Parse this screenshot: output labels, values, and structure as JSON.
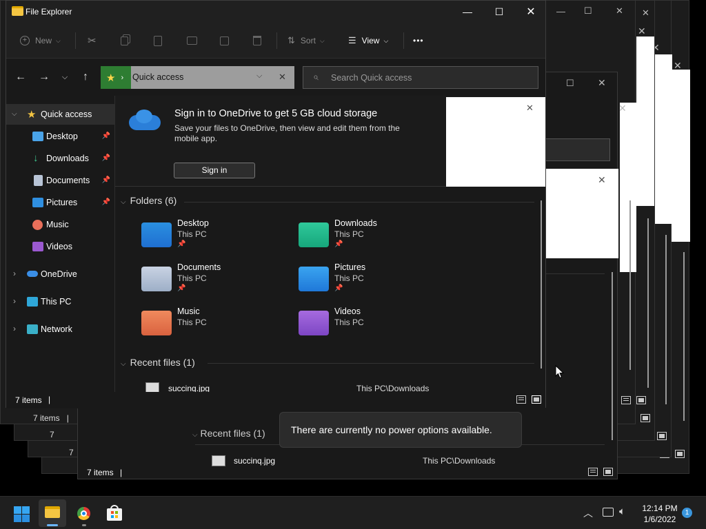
{
  "window": {
    "title": "File Explorer",
    "minimize": "—",
    "maximize": "☐",
    "close": "✕"
  },
  "toolbar": {
    "new_label": "New",
    "sort_label": "Sort",
    "view_label": "View",
    "more_label": "•••"
  },
  "address": {
    "location": "Quick access",
    "search_placeholder": "Search Quick access"
  },
  "sidebar": {
    "items": [
      {
        "label": "Quick access",
        "icon": "star-icon"
      },
      {
        "label": "Desktop",
        "icon": "desktop-icon"
      },
      {
        "label": "Downloads",
        "icon": "downloads-icon"
      },
      {
        "label": "Documents",
        "icon": "documents-icon"
      },
      {
        "label": "Pictures",
        "icon": "pictures-icon"
      },
      {
        "label": "Music",
        "icon": "music-icon"
      },
      {
        "label": "Videos",
        "icon": "videos-icon"
      },
      {
        "label": "OneDrive",
        "icon": "cloud-icon"
      },
      {
        "label": "This PC",
        "icon": "pc-icon"
      },
      {
        "label": "Network",
        "icon": "network-icon"
      }
    ]
  },
  "banner": {
    "title": "Sign in to OneDrive to get 5 GB cloud storage",
    "body": "Save your files to OneDrive, then view and edit them from the mobile app.",
    "button": "Sign in"
  },
  "folders": {
    "header": "Folders (6)",
    "items": [
      {
        "name": "Desktop",
        "location": "This PC",
        "pinned": true
      },
      {
        "name": "Downloads",
        "location": "This PC",
        "pinned": true
      },
      {
        "name": "Documents",
        "location": "This PC",
        "pinned": true
      },
      {
        "name": "Pictures",
        "location": "This PC",
        "pinned": true
      },
      {
        "name": "Music",
        "location": "This PC",
        "pinned": false
      },
      {
        "name": "Videos",
        "location": "This PC",
        "pinned": false
      }
    ]
  },
  "recent": {
    "header": "Recent files (1)",
    "file": "succinq.jpg",
    "path": "This PC\\Downloads"
  },
  "status": {
    "items": "7 items"
  },
  "toast": {
    "message": "There are currently no power options available."
  },
  "clock": {
    "time": "12:14 PM",
    "date": "1/6/2022",
    "badge": "1"
  }
}
